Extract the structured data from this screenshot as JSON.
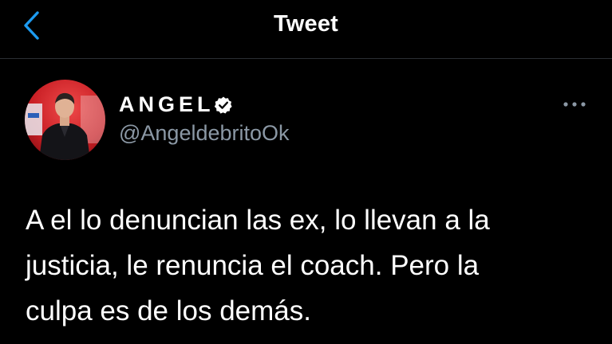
{
  "header": {
    "back_icon": "chevron-left-icon",
    "title": "Tweet",
    "accent_color": "#1d9bf0"
  },
  "author": {
    "display_name": "ANGEL",
    "verified_icon": "verified-badge-icon",
    "handle": "@AngeldebritoOk",
    "avatar_icon": "avatar-photo"
  },
  "more_icon": "more-options-icon",
  "tweet": {
    "lines": [
      "A el lo denuncian las ex, lo llevan a la",
      "justicia, le renuncia el coach. Pero la",
      "culpa es de los demás."
    ]
  },
  "colors": {
    "background": "#000000",
    "text": "#ffffff",
    "secondary_text": "#8b98a5",
    "divider": "#2a2e33"
  }
}
